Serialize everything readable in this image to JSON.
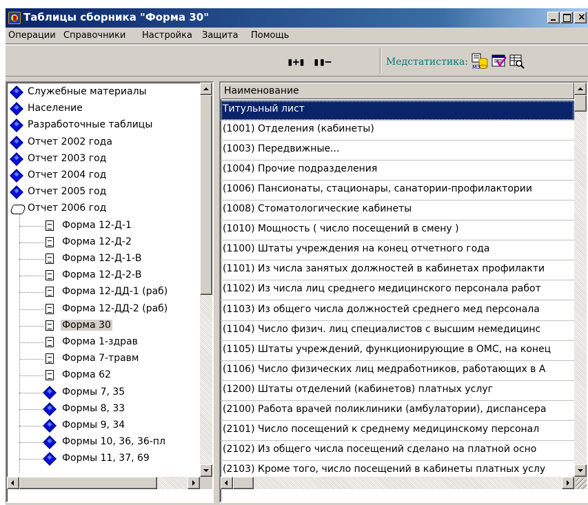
{
  "window": {
    "title": "Таблицы сборника \"Форма 30\"",
    "colors": {
      "titlebar_start": "#0a246a",
      "titlebar_end": "#a6caf0",
      "selection": "#0a246a",
      "medstat_text": "#007a7a"
    }
  },
  "menu": [
    "Операции",
    "Справочники",
    "Настройка",
    "Защита",
    "Помощь"
  ],
  "toolbar": {
    "expand_icon": "expand-icon",
    "collapse_icon": "collapse-icon",
    "medstat_label": "Медстатистика:",
    "mz_badge": "МЗ"
  },
  "tree": {
    "items": [
      {
        "label": "Служебные материалы",
        "icon": "diamond-icon",
        "level": 0
      },
      {
        "label": "Население",
        "icon": "diamond-icon",
        "level": 0
      },
      {
        "label": "Разработочные таблицы",
        "icon": "diamond-icon",
        "level": 0
      },
      {
        "label": "Отчет 2002 года",
        "icon": "diamond-icon",
        "level": 0
      },
      {
        "label": "Отчет 2003 год",
        "icon": "diamond-icon",
        "level": 0
      },
      {
        "label": "Отчет 2004 год",
        "icon": "diamond-icon",
        "level": 0
      },
      {
        "label": "Отчет 2005 год",
        "icon": "diamond-icon",
        "level": 0
      },
      {
        "label": "Отчет 2006 год",
        "icon": "open-book-icon",
        "level": 0
      },
      {
        "label": "Форма 12-Д-1",
        "icon": "document-icon",
        "level": 1
      },
      {
        "label": "Форма 12-Д-2",
        "icon": "document-icon",
        "level": 1
      },
      {
        "label": "Форма 12-Д-1-В",
        "icon": "document-icon",
        "level": 1
      },
      {
        "label": "Форма 12-Д-2-В",
        "icon": "document-icon",
        "level": 1
      },
      {
        "label": "Форма 12-ДД-1 (раб)",
        "icon": "document-icon",
        "level": 1
      },
      {
        "label": "Форма 12-ДД-2 (раб)",
        "icon": "document-icon",
        "level": 1
      },
      {
        "label": "Форма 30",
        "icon": "document-icon",
        "level": 1,
        "selected": true
      },
      {
        "label": "Форма 1-здрав",
        "icon": "document-icon",
        "level": 1
      },
      {
        "label": "Форма 7-травм",
        "icon": "document-icon",
        "level": 1
      },
      {
        "label": "Форма 62",
        "icon": "document-icon",
        "level": 1
      },
      {
        "label": "Формы 7, 35",
        "icon": "diamond-icon",
        "level": 1
      },
      {
        "label": "Формы 8, 33",
        "icon": "diamond-icon",
        "level": 1
      },
      {
        "label": "Формы 9, 34",
        "icon": "diamond-icon",
        "level": 1
      },
      {
        "label": "Формы 10, 36, 36-пл",
        "icon": "diamond-icon",
        "level": 1
      },
      {
        "label": "Формы 11, 37, 69",
        "icon": "diamond-icon",
        "level": 1
      }
    ]
  },
  "list": {
    "header": "Наименование",
    "rows": [
      {
        "text": "Титульный лист",
        "selected": true
      },
      {
        "text": "(1001) Отделения (кабинеты)"
      },
      {
        "text": "(1003) Передвижные..."
      },
      {
        "text": "(1004) Прочие подразделения"
      },
      {
        "text": "(1006) Пансионаты, стационары, санатории-профилактории"
      },
      {
        "text": "(1008) Стоматологические кабинеты"
      },
      {
        "text": "(1010) Мощность ( число посещений в смену )"
      },
      {
        "text": "(1100) Штаты учреждения на конец отчетного года"
      },
      {
        "text": "(1101) Из числа занятых должностей в кабинетах профилакти"
      },
      {
        "text": "(1102) Из числа лиц среднего медицинского персонала работ"
      },
      {
        "text": "(1103) Из общего числа должностей среднего мед персонала"
      },
      {
        "text": "(1104) Число физич. лиц специалистов с высшим немедицинс"
      },
      {
        "text": "(1105) Штаты учреждений, функционирующие в ОМС, на конец"
      },
      {
        "text": "(1106) Число физических лиц медработников, работающих в А"
      },
      {
        "text": "(1200) Штаты отделений (кабинетов) платных услуг"
      },
      {
        "text": "(2100) Работа врачей поликлиники (амбулатории), диспансера"
      },
      {
        "text": "(2101) Число посещений к среднему медицинскому персонал"
      },
      {
        "text": "(2102) Из общего числа посещений сделано на платной осно"
      },
      {
        "text": "(2103) Кроме того, число посещений в кабинеты платных услу"
      }
    ]
  }
}
